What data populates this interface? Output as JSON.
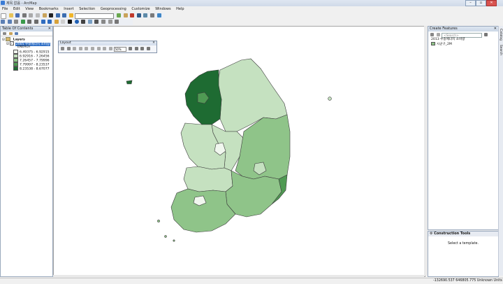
{
  "titlebar": {
    "title": "제목 없음 - ArcMap"
  },
  "menu": [
    "File",
    "Edit",
    "View",
    "Bookmarks",
    "Insert",
    "Selection",
    "Geoprocessing",
    "Customize",
    "Windows",
    "Help"
  ],
  "toc": {
    "title": "Table Of Contents",
    "layers_label": "Layers",
    "layer_name": "2005 수송에너지 소비량",
    "field_name": "ENERGY",
    "classes": [
      {
        "label": "6.49375 - 6.92915",
        "color": "#f1f7ef"
      },
      {
        "label": "6.92916 - 7.26456",
        "color": "#c5e1c0"
      },
      {
        "label": "7.26457 - 7.79996",
        "color": "#8fc489"
      },
      {
        "label": "7.79997 - 8.23537",
        "color": "#4f9a53"
      },
      {
        "label": "8.23538 - 8.67077",
        "color": "#1e6b32"
      }
    ]
  },
  "layout_toolbar": {
    "title": "Layout",
    "zoom": "50%"
  },
  "create_features": {
    "title": "Create Features",
    "search_placeholder": "<Search>",
    "group": "2013 수송에너지 소비량",
    "item": "시군구_2M"
  },
  "construction_tools": {
    "title": "Construction Tools",
    "hint": "Select a template."
  },
  "status": {
    "coords": "-132690.537  646805.775 Unknown Units"
  },
  "side_tabs": [
    "Catalog",
    "Search"
  ]
}
